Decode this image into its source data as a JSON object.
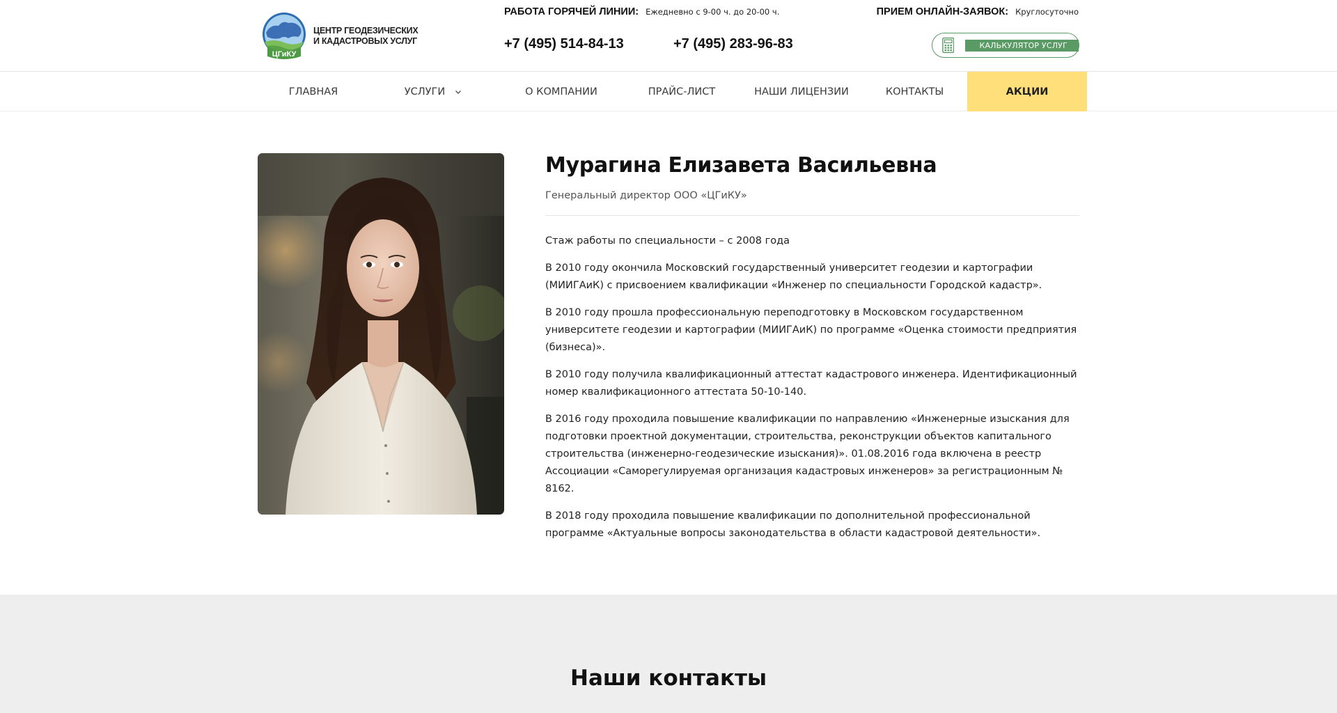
{
  "header": {
    "logo": {
      "line1": "ЦЕНТР ГЕОДЕЗИЧЕСКИХ",
      "line2": "И КАДАСТРОВЫХ УСЛУГ",
      "emblem_text": "ЦГиКУ"
    },
    "hotline": {
      "label": "РАБОТА ГОРЯЧЕЙ ЛИНИИ:",
      "value": "Ежедневно с 9-00 ч. до 20-00 ч."
    },
    "phones": [
      "+7 (495) 514-84-13",
      "+7 (495) 283-96-83"
    ],
    "online": {
      "label": "ПРИЕМ ОНЛАЙН-ЗАЯВОК:",
      "value": "Круглосуточно"
    },
    "calculator_button": "КАЛЬКУЛЯТОР УСЛУГ",
    "calculator_icon": "calculator-icon"
  },
  "nav": {
    "items": [
      {
        "label": "ГЛАВНАЯ"
      },
      {
        "label": "УСЛУГИ",
        "has_dropdown": true
      },
      {
        "label": "О КОМПАНИИ"
      },
      {
        "label": "ПРАЙС-ЛИСТ"
      },
      {
        "label": "НАШИ ЛИЦЕНЗИИ"
      },
      {
        "label": "КОНТАКТЫ"
      },
      {
        "label": "АКЦИИ",
        "highlight": true
      }
    ]
  },
  "profile": {
    "name": "Мурагина Елизавета Васильевна",
    "position": "Генеральный директор ООО «ЦГиКУ»",
    "bio": [
      "Стаж работы по специальности – с 2008 года",
      "В 2010 году окончила Московский государственный университет геодезии и картографии (МИИГАиК) с присвоением квалификации «Инженер по специальности Городской кадастр».",
      "В 2010 году прошла профессиональную переподготовку в Московском государственном университете геодезии и картографии (МИИГАиК) по программе «Оценка стоимости предприятия (бизнеса)».",
      "В 2010 году получила квалификационный аттестат кадастрового инженера. Идентификационный номер квалификационного аттестата 50-10-140.",
      "В 2016 году проходила повышение квалификации по направлению «Инженерные изыскания для подготовки проектной документации, строительства, реконструкции объектов капитального строительства (инженерно-геодезические изыскания)». 01.08.2016 года включена в реестр Ассоциации «Саморегулируемая организация кадастровых инженеров» за регистрационным № 8162.",
      "В 2018 году проходила повышение квалификации по дополнительной профессиональной программе «Актуальные вопросы законодательства в области кадастровой деятельности»."
    ]
  },
  "contacts": {
    "title": "Наши контакты"
  },
  "colors": {
    "accent_green": "#5a9a64",
    "promo_yellow": "#ffdf7a",
    "footer_bg": "#eeeeee"
  }
}
